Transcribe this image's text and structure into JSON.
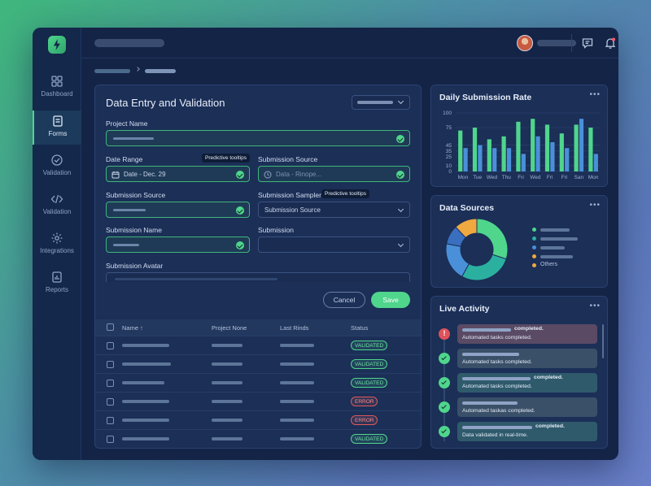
{
  "sidebar": {
    "items": [
      {
        "label": "Dashboard",
        "icon": "grid-icon"
      },
      {
        "label": "Forms",
        "icon": "form-icon",
        "active": true
      },
      {
        "label": "Validation",
        "icon": "check-circle-icon"
      },
      {
        "label": "Validation",
        "icon": "code-icon"
      },
      {
        "label": "Integrations",
        "icon": "gear-icon"
      },
      {
        "label": "Reports",
        "icon": "report-icon"
      }
    ]
  },
  "topbar": {
    "icons": [
      "chat-icon",
      "bell-icon",
      "settings-icon"
    ]
  },
  "form": {
    "title": "Data Entry and Validation",
    "project_name_label": "Project Name",
    "date_range_label": "Date Range",
    "date_range_value": "Date - Dec. 29",
    "tooltip_1": "Predictive tooltips",
    "submission_source_label": "Submission Source",
    "submission_source_placeholder": "Data - Rinope...",
    "submission_source_label_2": "Submission Source",
    "submission_sampler_label": "Submission Sampler",
    "tooltip_2": "Predictive tooltips",
    "submission_sampler_value": "Submission Source",
    "submission_name_label": "Submission Name",
    "submission_label": "Submission",
    "submission_avatar_label": "Submission Avatar",
    "cancel_label": "Cancel",
    "save_label": "Save"
  },
  "table": {
    "headers": [
      "Name",
      "Project None",
      "Last Rinds",
      "Status"
    ],
    "rows": [
      {
        "status": "VALIDATED",
        "kind": "ok"
      },
      {
        "status": "VALIDATED",
        "kind": "ok"
      },
      {
        "status": "VALIDATED",
        "kind": "ok"
      },
      {
        "status": "ERROR",
        "kind": "err"
      },
      {
        "status": "ERROR",
        "kind": "err"
      },
      {
        "status": "VALIDATED",
        "kind": "ok"
      }
    ]
  },
  "daily_chart": {
    "title": "Daily Submission Rate",
    "more": "•••",
    "chart_data": {
      "type": "bar",
      "categories": [
        "Mon",
        "Tue",
        "Wed",
        "Thu",
        "Fri",
        "Wed",
        "Fri",
        "Fri",
        "San",
        "Mon"
      ],
      "series": [
        {
          "color": "#4fd58c",
          "values": [
            70,
            75,
            55,
            60,
            85,
            90,
            80,
            65,
            80,
            75
          ]
        },
        {
          "color": "#4a90d9",
          "values": [
            40,
            45,
            40,
            40,
            30,
            60,
            50,
            40,
            90,
            30
          ]
        }
      ],
      "ylim": [
        0,
        100
      ],
      "yticks": [
        0,
        10,
        25,
        35,
        45,
        75,
        100
      ]
    }
  },
  "data_sources": {
    "title": "Data Sources",
    "more": "•••",
    "chart_data": {
      "type": "pie",
      "slices": [
        {
          "value": 30,
          "color": "#4fd58c"
        },
        {
          "value": 28,
          "color": "#2bb0a0"
        },
        {
          "value": 20,
          "color": "#4a90d9"
        },
        {
          "value": 10,
          "color": "#3a6fc0"
        },
        {
          "value": 12,
          "color": "#f0a840"
        }
      ]
    },
    "legend_other": "Others",
    "legend_colors": [
      "#4fd58c",
      "#2bb0a0",
      "#4a90d9",
      "#f0a840",
      "#f0a840"
    ]
  },
  "live_activity": {
    "title": "Live Activity",
    "more": "•••",
    "items": [
      {
        "kind": "error",
        "line1": "completed.",
        "line2": "Automated tasks completed."
      },
      {
        "kind": "ok",
        "line1": "",
        "line2": "Automated tasks completed."
      },
      {
        "kind": "ok",
        "line1": "completed.",
        "line2": "Automated tasks completed."
      },
      {
        "kind": "ok",
        "line1": "",
        "line2": "Automated taskas completed."
      },
      {
        "kind": "ok",
        "line1": "completed.",
        "line2": "Data validated in real-time."
      }
    ]
  }
}
